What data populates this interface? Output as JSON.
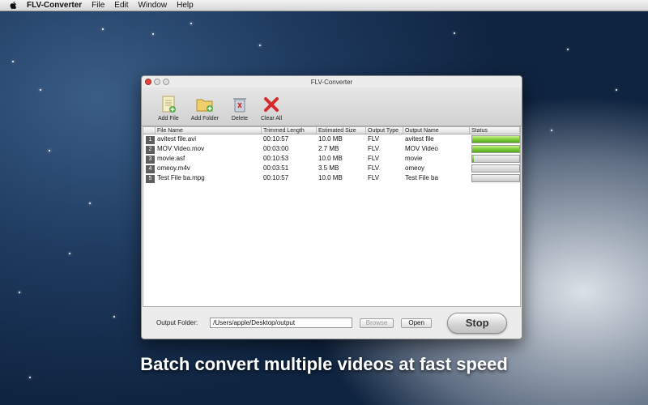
{
  "menubar": {
    "app_name": "FLV-Converter",
    "items": [
      "File",
      "Edit",
      "Window",
      "Help"
    ]
  },
  "window": {
    "title": "FLV-Converter",
    "toolbar": [
      {
        "label": "Add File",
        "icon": "add-file-icon"
      },
      {
        "label": "Add Folder",
        "icon": "add-folder-icon"
      },
      {
        "label": "Delete",
        "icon": "trash-icon"
      },
      {
        "label": "Clear All",
        "icon": "red-x-icon"
      }
    ],
    "table": {
      "headers": [
        "File Name",
        "Trimmed Length",
        "Estimated Size",
        "Output Type",
        "Output Name",
        "Status"
      ],
      "rows": [
        {
          "num": "1",
          "name": "avitest file.avi",
          "length": "00:10:57",
          "size": "10.0 MB",
          "type": "FLV",
          "output": "avitest file",
          "progress": 1.0
        },
        {
          "num": "2",
          "name": "MOV Video.mov",
          "length": "00:03:00",
          "size": "2.7 MB",
          "type": "FLV",
          "output": "MOV Video",
          "progress": 1.0
        },
        {
          "num": "3",
          "name": "movie.asf",
          "length": "00:10:53",
          "size": "10.0 MB",
          "type": "FLV",
          "output": "movie",
          "progress": 0.04
        },
        {
          "num": "4",
          "name": "omeoy.m4v",
          "length": "00:03:51",
          "size": "3.5 MB",
          "type": "FLV",
          "output": "omeoy",
          "progress": 0.0
        },
        {
          "num": "5",
          "name": "Test File ba.mpg",
          "length": "00:10:57",
          "size": "10.0 MB",
          "type": "FLV",
          "output": "Test File ba",
          "progress": 0.0
        }
      ]
    },
    "output_folder_label": "Output Folder:",
    "output_folder_value": "/Users/apple/Desktop/output",
    "browse_label": "Browse",
    "open_label": "Open",
    "stop_label": "Stop"
  },
  "caption": "Batch convert multiple videos at fast speed",
  "colors": {
    "progress_green": "#7fcf3a",
    "close_red": "#e0443e",
    "desktop_blue": "#1f3b60"
  }
}
